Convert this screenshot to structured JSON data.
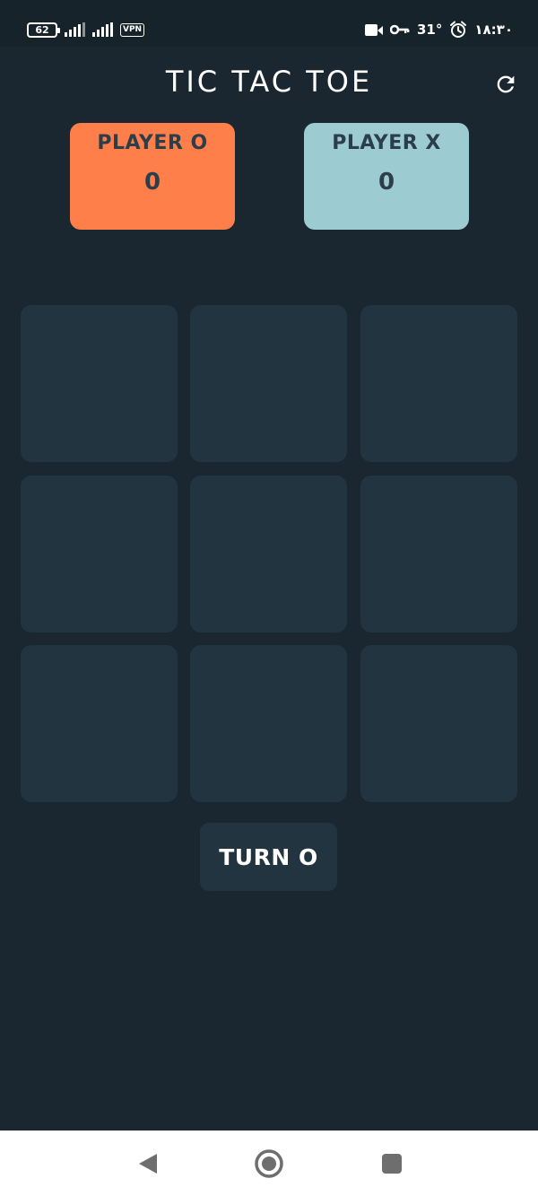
{
  "status_bar": {
    "battery": "62",
    "vpn": "VPN",
    "temperature": "31°",
    "time": "۱۸:۳۰",
    "icons": [
      "battery-icon",
      "signal-icon",
      "signal-icon",
      "vpn-icon",
      "video-camera-icon",
      "key-icon",
      "alarm-clock-icon"
    ]
  },
  "header": {
    "title": "TIC TAC TOE",
    "refresh_icon": "refresh-icon"
  },
  "players": [
    {
      "label": "PLAYER O",
      "score": "0",
      "color": "#ff7f4a"
    },
    {
      "label": "PLAYER X",
      "score": "0",
      "color": "#9ccbd2"
    }
  ],
  "board": {
    "cells": [
      "",
      "",
      "",
      "",
      "",
      "",
      "",
      "",
      ""
    ]
  },
  "turn": {
    "label": "TURN O"
  },
  "colors": {
    "background": "#1a2730",
    "cell": "#213440",
    "text": "#ffffff"
  },
  "nav": {
    "icons": [
      "back-icon",
      "home-icon",
      "recents-icon"
    ]
  }
}
